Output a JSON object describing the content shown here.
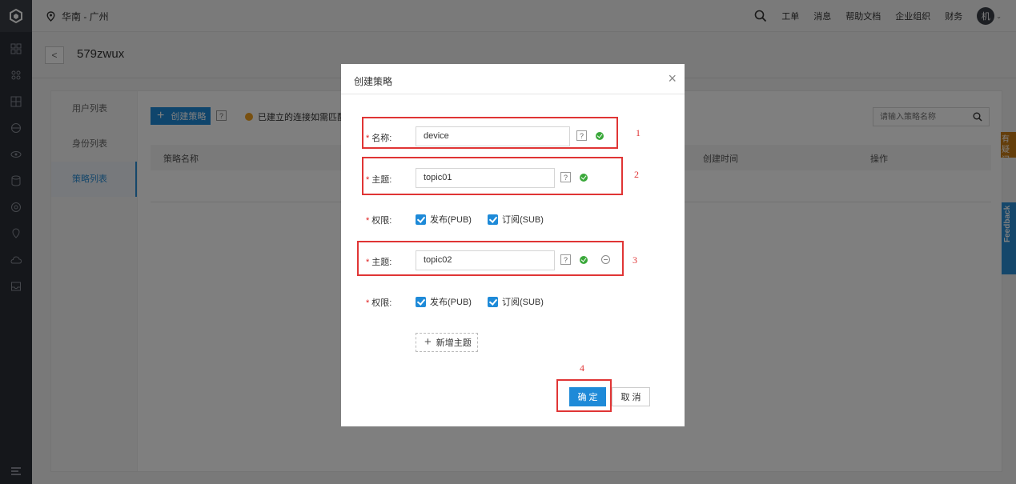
{
  "topbar": {
    "region": "华南 - 广州",
    "nav": [
      "工单",
      "消息",
      "帮助文档",
      "企业组织",
      "财务"
    ],
    "avatar": "机"
  },
  "page": {
    "title": "579zwux",
    "back_label": "<"
  },
  "subnav": {
    "items": [
      "用户列表",
      "身份列表",
      "策略列表"
    ],
    "active": "策略列表"
  },
  "toolbar": {
    "create_label": "创建策略",
    "help_label": "?",
    "notice": "已建立的连接如需匹配",
    "search_placeholder": "请输入策略名称"
  },
  "table": {
    "columns": [
      "策略名称",
      "创建时间",
      "操作"
    ]
  },
  "side_tag": "有疑问",
  "feedback_label": "Feedback",
  "modal": {
    "title": "创建策略",
    "close": "×",
    "name_label": "名称:",
    "name_value": "device",
    "topic_label": "主题:",
    "topics": [
      {
        "value": "topic01",
        "perm_label": "权限:",
        "pub": "发布(PUB)",
        "sub": "订阅(SUB)"
      },
      {
        "value": "topic02",
        "perm_label": "权限:",
        "pub": "发布(PUB)",
        "sub": "订阅(SUB)"
      }
    ],
    "help": "?",
    "add_topic": "新增主题",
    "confirm": "确 定",
    "cancel": "取 消"
  },
  "annotations": [
    "1",
    "2",
    "3",
    "4"
  ]
}
